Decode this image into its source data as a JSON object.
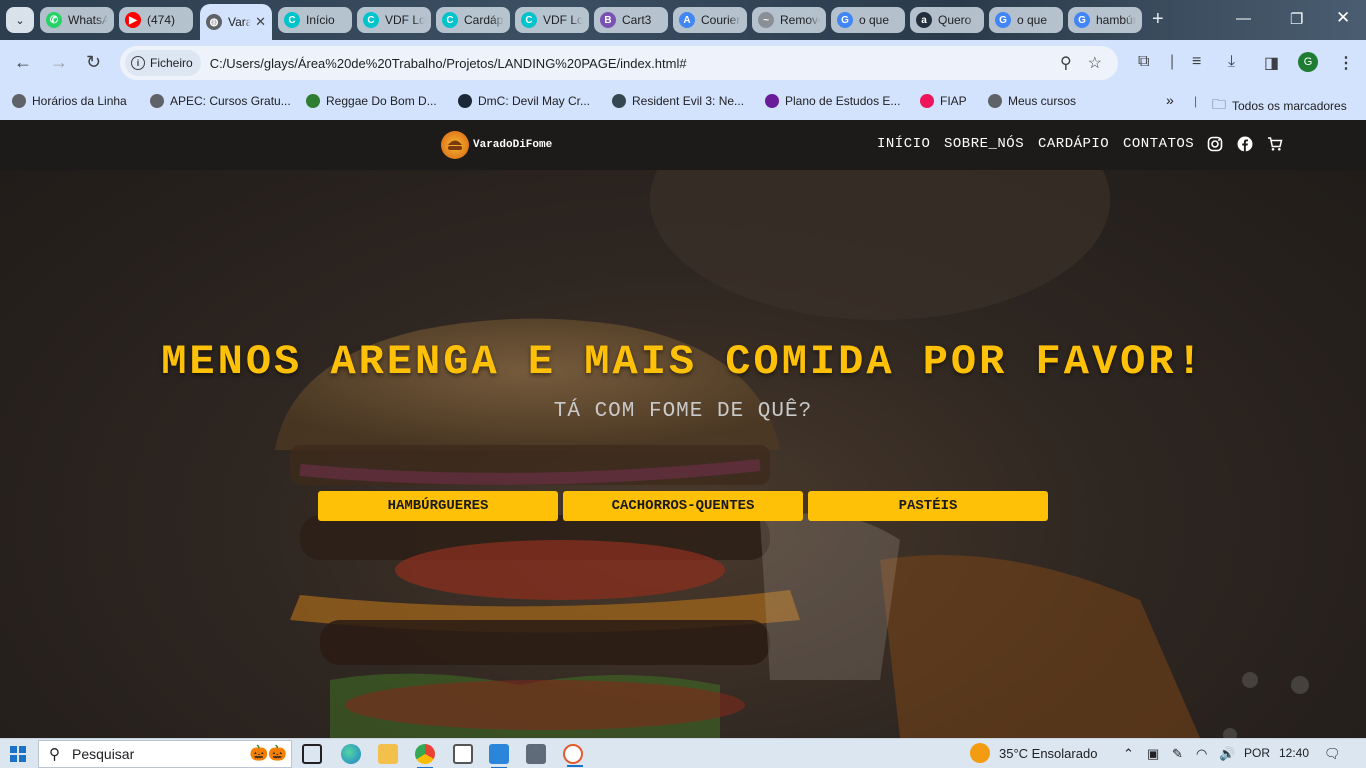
{
  "browser": {
    "tabs": [
      {
        "title": "WhatsApp",
        "icon": "whatsapp-icon",
        "color": "#25d366",
        "glyph": "✆"
      },
      {
        "title": "(474)",
        "icon": "youtube-icon",
        "color": "#ff0000",
        "glyph": "▶"
      },
      {
        "title": "VaradoDiFome",
        "icon": "globe-icon",
        "color": "#5f6368",
        "glyph": "◍",
        "active": true
      },
      {
        "title": "Início",
        "icon": "canva-icon",
        "color": "#00c4cc",
        "glyph": "C"
      },
      {
        "title": "VDF Logo",
        "icon": "canva-icon",
        "color": "#00c4cc",
        "glyph": "C"
      },
      {
        "title": "Cardápio",
        "icon": "canva-icon",
        "color": "#00c4cc",
        "glyph": "C"
      },
      {
        "title": "VDF Logo",
        "icon": "canva-icon",
        "color": "#00c4cc",
        "glyph": "C"
      },
      {
        "title": "Cart3",
        "icon": "bootstrap-icon",
        "color": "#7952b3",
        "glyph": "B"
      },
      {
        "title": "Courier",
        "icon": "google-fonts-icon",
        "color": "#4285f4",
        "glyph": "A"
      },
      {
        "title": "Remove",
        "icon": "remove-bg-icon",
        "color": "#8a8f96",
        "glyph": "~"
      },
      {
        "title": "o que",
        "icon": "google-icon",
        "color": "#4285f4",
        "glyph": "G"
      },
      {
        "title": "Quero",
        "icon": "amazon-icon",
        "color": "#232f3e",
        "glyph": "a"
      },
      {
        "title": "o que",
        "icon": "google-icon",
        "color": "#4285f4",
        "glyph": "G"
      },
      {
        "title": "hambúrguer",
        "icon": "google-icon",
        "color": "#4285f4",
        "glyph": "G"
      }
    ],
    "new_tab": "+",
    "omnibox": {
      "chip_label": "Ficheiro",
      "url": "C:/Users/glays/Área%20de%20Trabalho/Projetos/LANDING%20PAGE/index.html#"
    },
    "profile_initial": "G",
    "bookmarks": [
      {
        "label": "Horários da Linha",
        "icon": "globe-icon",
        "color": "#5f6368"
      },
      {
        "label": "APEC: Cursos Gratu...",
        "icon": "globe-icon",
        "color": "#5f6368"
      },
      {
        "label": "Reggae Do Bom D...",
        "icon": "reggae-icon",
        "color": "#2e7d32"
      },
      {
        "label": "DmC: Devil May Cr...",
        "icon": "steam-icon",
        "color": "#1b2838"
      },
      {
        "label": "Resident Evil 3: Ne...",
        "icon": "eye-icon",
        "color": "#37474f"
      },
      {
        "label": "Plano de Estudos E...",
        "icon": "study-icon",
        "color": "#6a1b9a"
      },
      {
        "label": "FIAP",
        "icon": "fiap-icon",
        "color": "#ed145b"
      },
      {
        "label": "Meus cursos",
        "icon": "globe-icon",
        "color": "#5f6368"
      }
    ],
    "more_bookmarks": "»",
    "all_bookmarks": "Todos os marcadores"
  },
  "site": {
    "logo_text": "VaradoDiFome",
    "nav": [
      "INÍCIO",
      "SOBRE_NÓS",
      "CARDÁPIO",
      "CONTATOS"
    ],
    "headline": "MENOS ARENGA E MAIS COMIDA POR FAVOR!",
    "subline": "TÁ COM FOME DE QUÊ?",
    "buttons": [
      "HAMBÚRGUERES",
      "CACHORROS-QUENTES",
      "PASTÉIS"
    ],
    "accent": "#ffc107"
  },
  "taskbar": {
    "search_label": "Pesquisar",
    "weather": "35°C  Ensolarado",
    "language": "POR",
    "time": "12:40"
  }
}
